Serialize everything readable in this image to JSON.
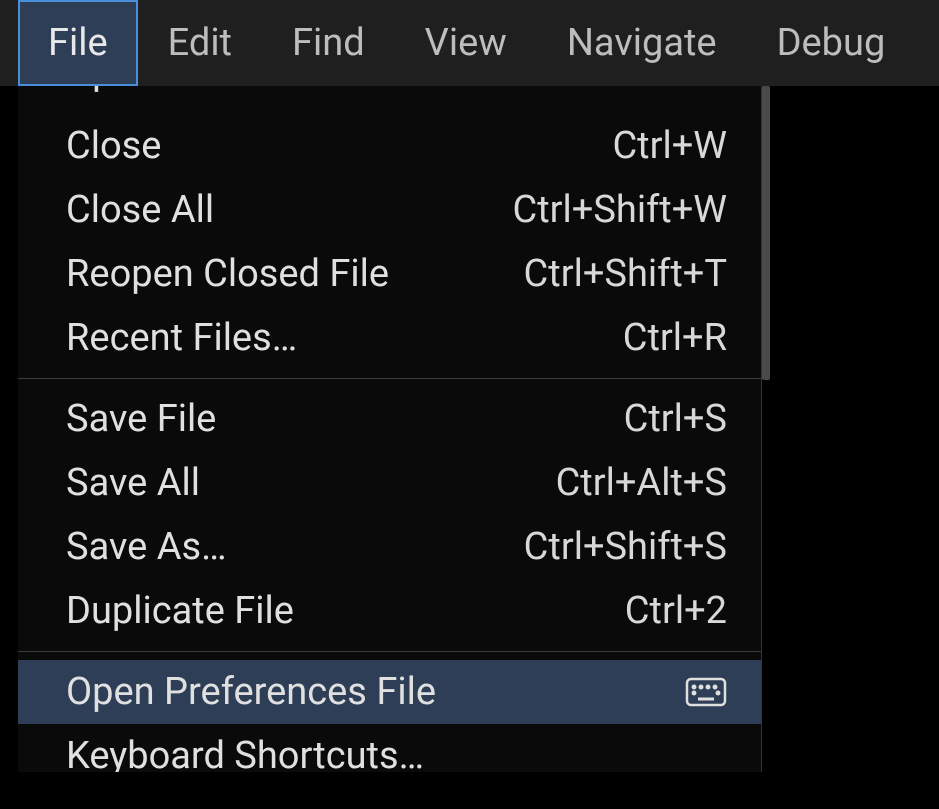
{
  "menubar": {
    "items": [
      {
        "label": "File",
        "active": true
      },
      {
        "label": "Edit",
        "active": false
      },
      {
        "label": "Find",
        "active": false
      },
      {
        "label": "View",
        "active": false
      },
      {
        "label": "Navigate",
        "active": false
      },
      {
        "label": "Debug",
        "active": false
      }
    ]
  },
  "dropdown": {
    "items": [
      {
        "label": "Open Folder…",
        "shortcut": "",
        "partial": "top"
      },
      {
        "label": "Close",
        "shortcut": "Ctrl+W"
      },
      {
        "label": "Close All",
        "shortcut": "Ctrl+Shift+W"
      },
      {
        "label": "Reopen Closed File",
        "shortcut": "Ctrl+Shift+T"
      },
      {
        "label": "Recent Files…",
        "shortcut": "Ctrl+R"
      },
      {
        "separator": true
      },
      {
        "label": "Save File",
        "shortcut": "Ctrl+S"
      },
      {
        "label": "Save All",
        "shortcut": "Ctrl+Alt+S"
      },
      {
        "label": "Save As…",
        "shortcut": "Ctrl+Shift+S"
      },
      {
        "label": "Duplicate File",
        "shortcut": "Ctrl+2"
      },
      {
        "separator": true
      },
      {
        "label": "Open Preferences File",
        "shortcut": "",
        "icon": "keyboard-icon",
        "highlighted": true
      },
      {
        "label": "Keyboard Shortcuts…",
        "shortcut": "",
        "partial": "bottom"
      }
    ]
  }
}
